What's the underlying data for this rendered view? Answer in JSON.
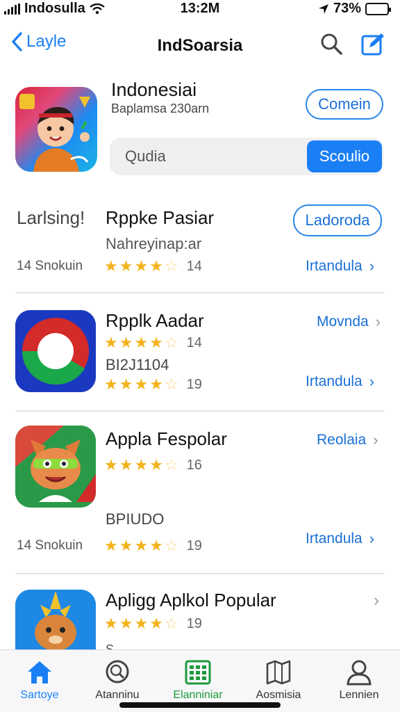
{
  "status_bar": {
    "carrier": "Indosulla",
    "time": "13:2M",
    "battery": "73%",
    "battery_level": 0.73
  },
  "nav": {
    "back_label": "Layle",
    "title": "IndSoarsia",
    "icons": [
      "search-icon",
      "compose-icon"
    ]
  },
  "featured": {
    "name": "Indonesiai",
    "subtitle": "Baplamsa 230arn",
    "action_label": "Comein",
    "search_placeholder": "Qudia",
    "search_button": "Scoulio"
  },
  "section_header": "Larlsing!",
  "rows": [
    {
      "title": "Rppke Pasiar",
      "subtitle": "Nahreyinap:ar",
      "action_label": "Ladoroda",
      "meta": "14 Snokuin",
      "rating": 4.5,
      "rating_count": "14",
      "link": "Irtandula"
    },
    {
      "title": "Rpplk Aadar",
      "top_link": "Movnda",
      "rating1": 4.5,
      "rating1_count": "14",
      "code": "BI2J1104",
      "rating2": 4.5,
      "rating2_count": "19",
      "link": "Irtandula"
    },
    {
      "title": "Appla Fespolar",
      "top_link": "Reolaia",
      "rating": 4,
      "rating_count": "16",
      "code": "BPIUDO",
      "meta": "14 Snokuin",
      "rating2": 4,
      "rating2_count": "19",
      "link": "Irtandula"
    },
    {
      "title": "Apligg Aplkol Popular",
      "rating": 4,
      "rating_count": "19",
      "extra": "S..."
    }
  ],
  "tabs": [
    {
      "label": "Sartoye",
      "icon": "home-icon",
      "active": true,
      "color": "#1a7ff5"
    },
    {
      "label": "Atanninu",
      "icon": "search-icon",
      "active": false
    },
    {
      "label": "Elanniniar",
      "icon": "grid-icon",
      "active": false,
      "color": "#1c9a3c"
    },
    {
      "label": "Aosmisia",
      "icon": "map-icon",
      "active": false
    },
    {
      "label": "Lennien",
      "icon": "person-icon",
      "active": false
    }
  ],
  "colors": {
    "accent": "#1a7ff5",
    "star": "#f2b31c",
    "tab_green": "#1c9a3c"
  }
}
